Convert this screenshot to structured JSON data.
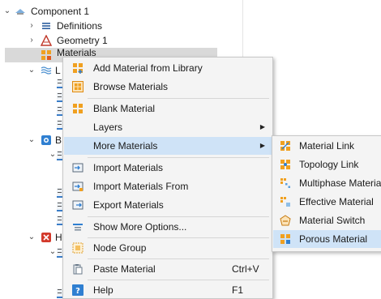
{
  "tree": {
    "component": "Component 1",
    "definitions": "Definitions",
    "geometry": "Geometry 1",
    "materials": "Materials",
    "collapsed_nodes": [
      {
        "label": "L",
        "icon": "waves-icon"
      },
      {
        "label": "B",
        "icon": "blue-physics-icon"
      },
      {
        "label": "H",
        "icon": "red-physics-icon"
      }
    ]
  },
  "context_menu": {
    "items": [
      {
        "label": "Add Material from Library",
        "icon": "add-material-icon"
      },
      {
        "label": "Browse Materials",
        "icon": "browse-materials-icon"
      },
      {
        "label": "Blank Material",
        "icon": "blank-material-icon"
      },
      {
        "label": "Layers",
        "icon": "",
        "submenu": true
      },
      {
        "label": "More Materials",
        "icon": "",
        "submenu": true
      },
      {
        "label": "Import Materials",
        "icon": "import-icon"
      },
      {
        "label": "Import Materials From",
        "icon": "import-from-icon"
      },
      {
        "label": "Export Materials",
        "icon": "export-icon"
      },
      {
        "label": "Show More Options...",
        "icon": "options-icon"
      },
      {
        "label": "Node Group",
        "icon": "node-group-icon"
      },
      {
        "label": "Paste Material",
        "icon": "paste-icon",
        "shortcut": "Ctrl+V"
      },
      {
        "label": "Help",
        "icon": "help-icon",
        "shortcut": "F1"
      }
    ],
    "hovered": "More Materials",
    "arrow": "▶"
  },
  "submenu": {
    "items": [
      {
        "label": "Material Link",
        "icon": "material-link-icon"
      },
      {
        "label": "Topology Link",
        "icon": "topology-link-icon"
      },
      {
        "label": "Multiphase Material",
        "icon": "multiphase-material-icon"
      },
      {
        "label": "Effective Material",
        "icon": "effective-material-icon"
      },
      {
        "label": "Material Switch",
        "icon": "material-switch-icon"
      },
      {
        "label": "Porous Material",
        "icon": "porous-material-icon"
      }
    ],
    "hovered": "Porous Material"
  },
  "colors": {
    "hover": "#cfe3f7",
    "selected_row": "#d9d9d9",
    "menu_bg": "#f4f4f4",
    "accent_orange": "#f0a020",
    "accent_blue": "#3a7dc8"
  }
}
